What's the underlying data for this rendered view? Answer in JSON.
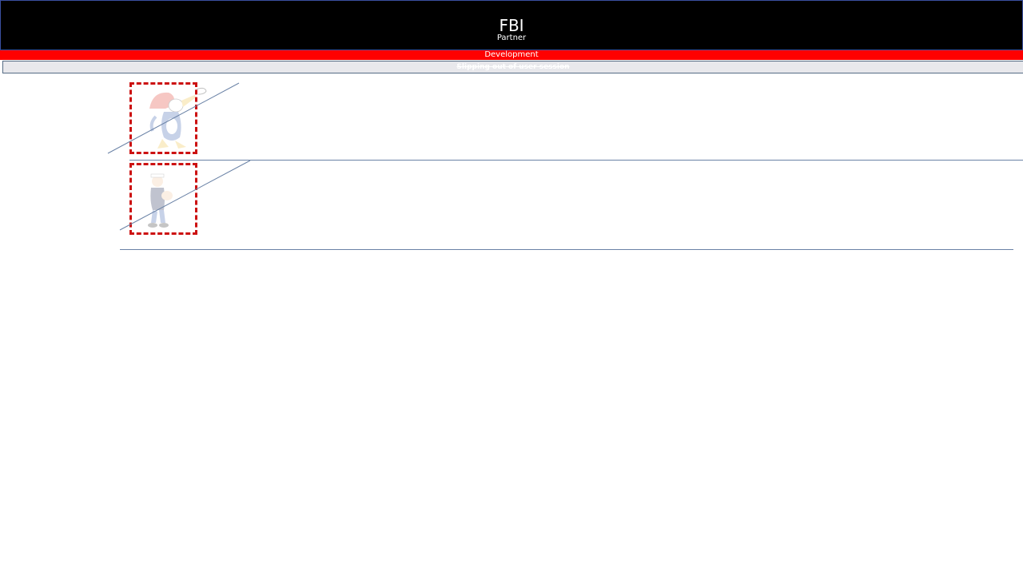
{
  "header": {
    "title": "FBI",
    "subtitle": "Partner"
  },
  "environment": {
    "label": "Development"
  },
  "notice": {
    "text": "Slipping out of user session"
  },
  "items": [
    {
      "image": "woodpecker-cartoon-icon"
    },
    {
      "image": "sailor-cartoon-icon"
    }
  ],
  "colors": {
    "header_bg": "#000000",
    "env_bar": "#ff0000",
    "thumb_border": "#cc1111",
    "rule": "#6a82a6"
  }
}
